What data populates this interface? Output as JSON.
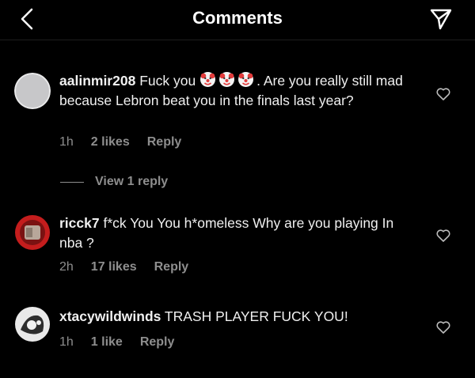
{
  "header": {
    "title": "Comments",
    "back_icon": "chevron-left-icon",
    "send_icon": "paper-plane-icon"
  },
  "comments": [
    {
      "username": "aalinmir208",
      "text_before": "Fuck you",
      "emojis": [
        "clown-face",
        "clown-face",
        "clown-face"
      ],
      "text_after": ". Are you really still mad because Lebron beat you in the finals last year?",
      "time": "1h",
      "likes": "2 likes",
      "reply": "Reply",
      "view_replies": "View 1 reply"
    },
    {
      "username": "ricck7",
      "text": "f*ck You You h*omeless Why are you playing In nba ?",
      "time": "2h",
      "likes": "17 likes",
      "reply": "Reply"
    },
    {
      "username": "xtacywildwinds",
      "text": "TRASH PLAYER FUCK YOU!",
      "time": "1h",
      "likes": "1 like",
      "reply": "Reply"
    }
  ],
  "colors": {
    "background": "#000000",
    "text": "#f5f5f5",
    "muted": "#8e8e8e"
  }
}
